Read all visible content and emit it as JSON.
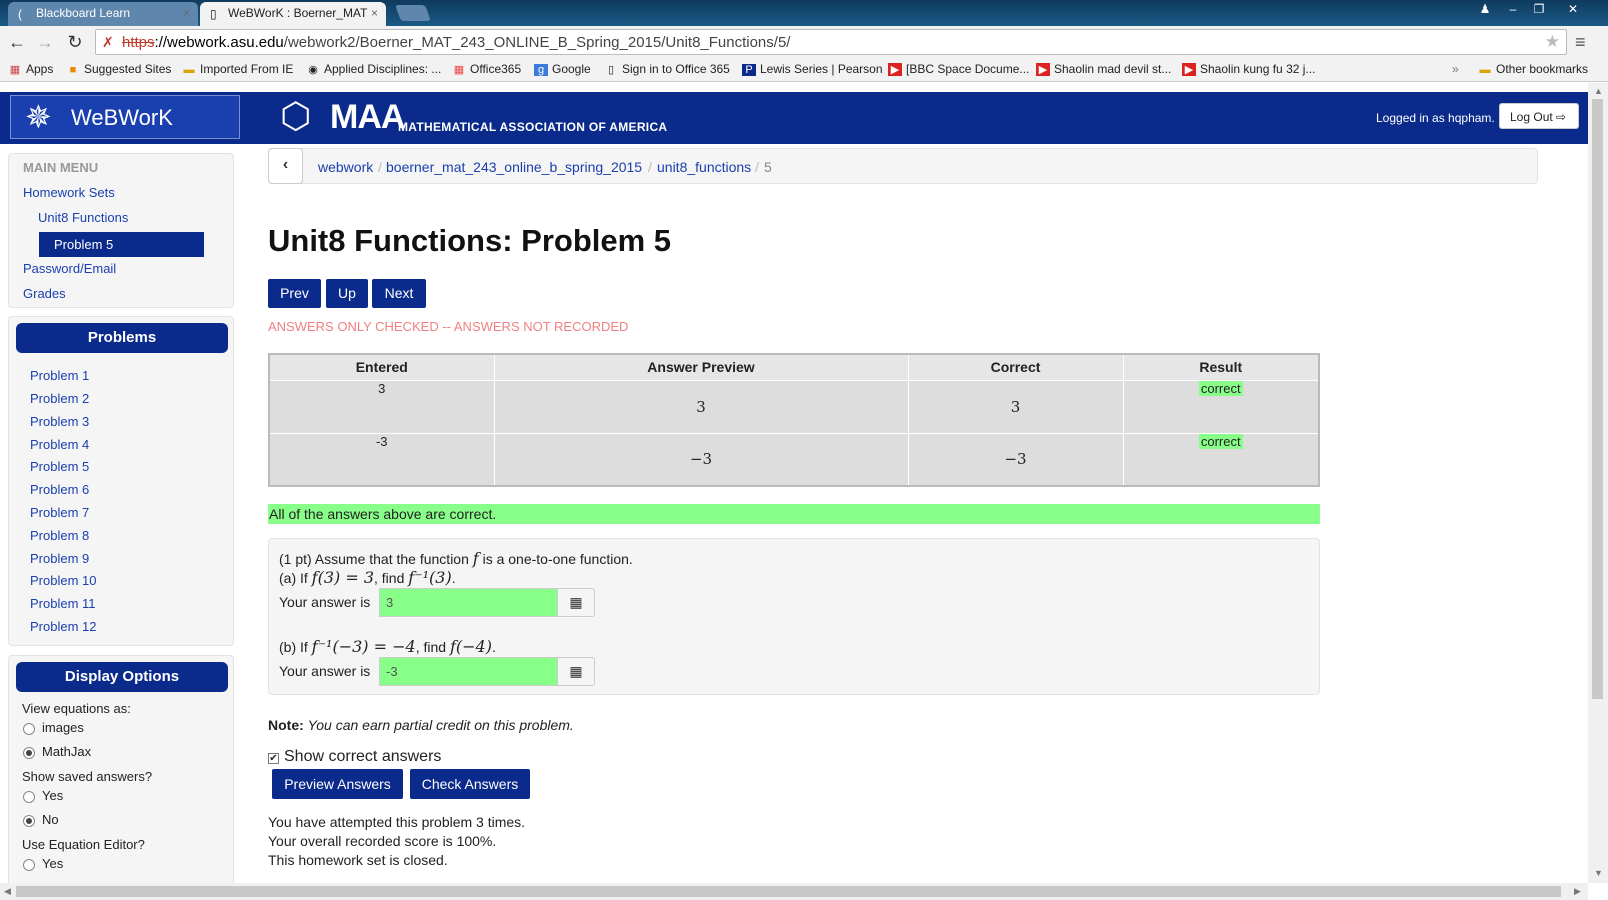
{
  "browser": {
    "tabs": [
      {
        "title": "Blackboard Learn",
        "active": false
      },
      {
        "title": "WeBWorK : Boerner_MAT",
        "active": true
      }
    ],
    "url": {
      "scheme": "https",
      "host": "://webwork.asu.edu",
      "path": "/webwork2/Boerner_MAT_243_ONLINE_B_Spring_2015/Unit8_Functions/5/"
    },
    "bookmarks": [
      "Apps",
      "Suggested Sites",
      "Imported From IE",
      "Applied Disciplines: ...",
      "Office365",
      "Google",
      "Sign in to Office 365",
      "Lewis Series | Pearson",
      "[BBC Space Docume...",
      "Shaolin mad devil st...",
      "Shaolin kung fu 32 j...",
      "»",
      "Other bookmarks"
    ]
  },
  "header": {
    "logo_text": "WeBWorK",
    "maa_big": "MAA",
    "maa_small": "MATHEMATICAL ASSOCIATION OF AMERICA",
    "logged_in": "Logged in as hqpham.",
    "logout_label": "Log Out"
  },
  "main_menu": {
    "title": "MAIN MENU",
    "items": [
      "Homework Sets",
      "Unit8 Functions",
      "Problem 5",
      "Password/Email",
      "Grades"
    ]
  },
  "problems_panel": {
    "title": "Problems",
    "items": [
      "Problem 1",
      "Problem 2",
      "Problem 3",
      "Problem 4",
      "Problem 5",
      "Problem 6",
      "Problem 7",
      "Problem 8",
      "Problem 9",
      "Problem 10",
      "Problem 11",
      "Problem 12"
    ]
  },
  "display_options": {
    "title": "Display Options",
    "view_equations_label": "View equations as:",
    "view_options": [
      "images",
      "MathJax"
    ],
    "view_selected": "MathJax",
    "show_saved_label": "Show saved answers?",
    "saved_options": [
      "Yes",
      "No"
    ],
    "saved_selected": "No",
    "equation_editor_label": "Use Equation Editor?",
    "equation_editor_first": "Yes"
  },
  "breadcrumb": [
    "webwork",
    "boerner_mat_243_online_b_spring_2015",
    "unit8_functions",
    "5"
  ],
  "page_title": "Unit8 Functions: Problem 5",
  "nav_buttons": [
    "Prev",
    "Up",
    "Next"
  ],
  "answers_notice": "ANSWERS ONLY CHECKED -- ANSWERS NOT RECORDED",
  "results_table": {
    "headers": [
      "Entered",
      "Answer Preview",
      "Correct",
      "Result"
    ],
    "rows": [
      {
        "entered": "3",
        "preview": "3",
        "correct": "3",
        "result": "correct"
      },
      {
        "entered": "-3",
        "preview": "−3",
        "correct": "−3",
        "result": "correct"
      }
    ]
  },
  "all_correct_message": "All of the answers above are correct.",
  "problem": {
    "intro_prefix": "(1 pt) Assume that the function",
    "intro_fn": "f",
    "intro_suffix": "is a one-to-one function.",
    "part_a_prefix": "(a) If",
    "part_a_cond": "f(3) = 3",
    "part_a_find": ", find",
    "part_a_target": "f⁻¹(3)",
    "part_b_prefix": "(b) If",
    "part_b_cond": "f⁻¹(−3) = −4",
    "part_b_find": ", find",
    "part_b_target": "f(−4)",
    "answer_label": "Your answer is",
    "answer_a": "3",
    "answer_b": "-3"
  },
  "note": {
    "label": "Note:",
    "text": "You can earn partial credit on this problem."
  },
  "show_correct_label": "Show correct answers",
  "action_buttons": {
    "preview": "Preview Answers",
    "check": "Check Answers"
  },
  "status_lines": [
    "You have attempted this problem 3 times.",
    "Your overall recorded score is 100%.",
    "This homework set is closed."
  ],
  "colors": {
    "navy": "#0b2b8c",
    "correct_green": "#88ff88",
    "notice_pink": "#f08080"
  }
}
